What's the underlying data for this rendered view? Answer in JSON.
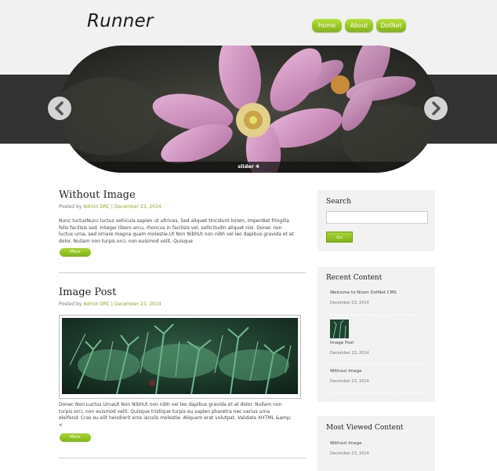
{
  "site": {
    "title": "Runner"
  },
  "nav": [
    "Home",
    "About",
    "DotNet"
  ],
  "slider": {
    "caption": "slider 4"
  },
  "posts": [
    {
      "title": "Without Image",
      "meta_prefix": "Posted by",
      "author": "Admin DRC",
      "separator": "|",
      "date": "December 23, 2014",
      "lines": [
        "Nunc luctusNunc luctus vehicula sapien ut ultrices. Sed aliquet tincidunt lorem, imperdiet fringilla",
        "felis facilisis sed. Integer libero arcu, rhoncus in facilisis vel, sollicitudin aliquet nisi. Donec non",
        "luctus urna, sed ornare magna quam molestie.Ut Non NibhUt non nibh vel leo dapibus gravida et at",
        "dolor. Nullam non turpis orci, non euismod velit. Quisque"
      ],
      "more": "More"
    },
    {
      "title": "Image Post",
      "meta_prefix": "Posted by",
      "author": "Admin DRC",
      "separator": "|",
      "date": "December 23, 2014",
      "lines": [
        "Donec Non Luctus UrnaUt Non NibhUt non nibh vel leo dapibus gravida et at dolor. Nullam non",
        "turpis orci, non euismod velit. Quisque tristique turpis eu sapien pharetra nec varius urna",
        "eleifend. Cras eu elit hendrerit eros iaculis molestie. Aliquam erat volutpat. Validate XHTML &amp;",
        "<"
      ],
      "more": "More"
    }
  ],
  "search": {
    "title": "Search",
    "placeholder": "",
    "button": "Go"
  },
  "recent": {
    "title": "Recent Content",
    "items": [
      {
        "label": "Welcome to Nixon DotNet CMS",
        "date": "December 23, 2014"
      },
      {
        "label": "Image Post",
        "date": "December 23, 2014"
      },
      {
        "label": "Without Image",
        "date": "December 23, 2014"
      }
    ]
  },
  "most_viewed": {
    "title": "Most Viewed Content",
    "items": [
      {
        "label": "Without Image",
        "date": "December 23, 2014"
      }
    ]
  },
  "colors": {
    "accent": "#7fb315",
    "band": "#333333",
    "header_bg": "#f1f1f1"
  }
}
